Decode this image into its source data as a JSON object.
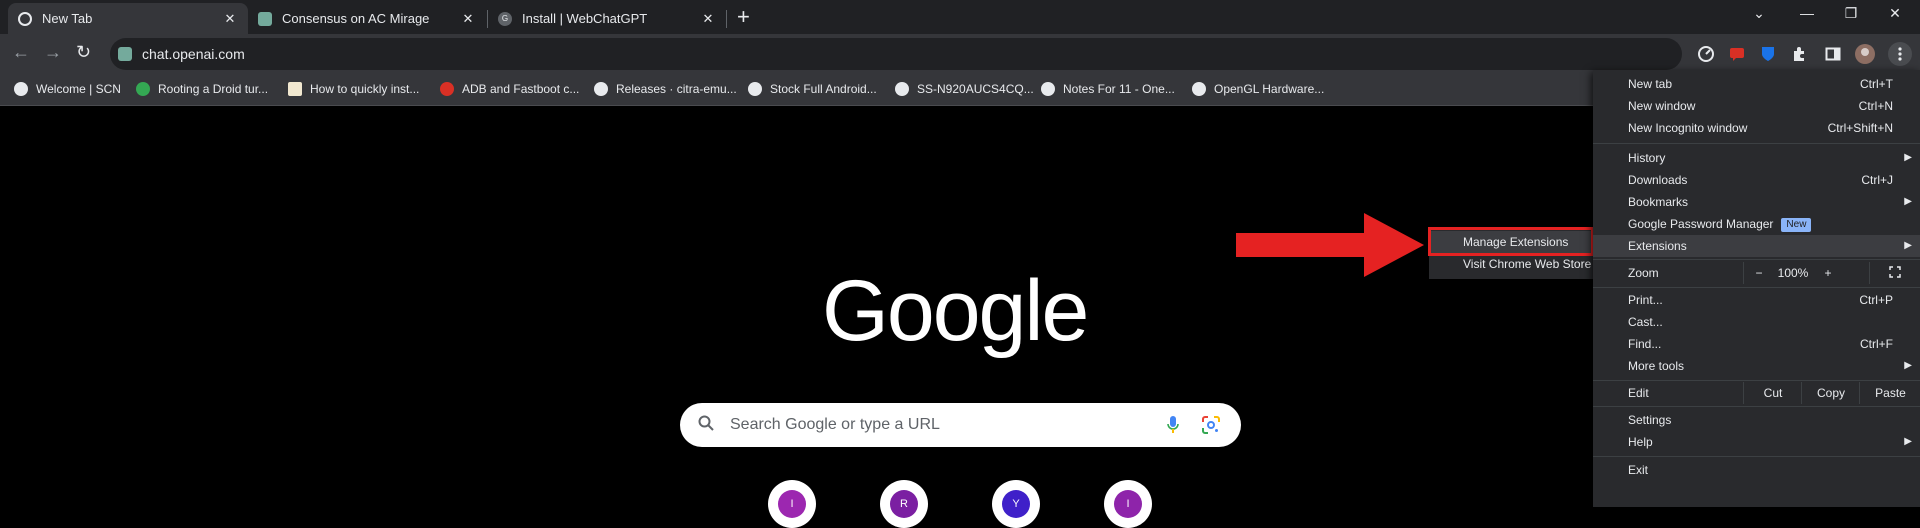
{
  "tabs": [
    {
      "title": "New Tab",
      "active": true
    },
    {
      "title": "Consensus on AC Mirage",
      "active": false
    },
    {
      "title": "Install | WebChatGPT",
      "active": false
    }
  ],
  "tab_close_glyph": "✕",
  "new_tab_glyph": "+",
  "window_controls": {
    "dropdown": "⌄",
    "minimize": "—",
    "restore": "❐",
    "close": "✕"
  },
  "toolbar": {
    "back_glyph": "←",
    "forward_glyph": "→",
    "reload_glyph": "↻",
    "url": "chat.openai.com"
  },
  "bookmarks": [
    {
      "label": "Welcome | SCN",
      "color": "#e8eaed"
    },
    {
      "label": "Rooting a Droid tur...",
      "color": "#34a853"
    },
    {
      "label": "How to quickly inst...",
      "color": "#f1e8d0"
    },
    {
      "label": "ADB and Fastboot c...",
      "color": "#d93025"
    },
    {
      "label": "Releases · citra-emu...",
      "color": "#e8eaed"
    },
    {
      "label": "Stock Full Android...",
      "color": "#e8eaed"
    },
    {
      "label": "SS-N920AUCS4CQ...",
      "color": "#e8eaed"
    },
    {
      "label": "Notes For 11 - One...",
      "color": "#e8eaed"
    },
    {
      "label": "OpenGL Hardware...",
      "color": "#e8eaed"
    }
  ],
  "page": {
    "logo": "Google",
    "search_placeholder": "Search Google or type a URL",
    "shortcuts": [
      {
        "letter": "I",
        "color": "#9c27b0"
      },
      {
        "letter": "R",
        "color": "#7b1fa2"
      },
      {
        "letter": "Y",
        "color": "#3f20c9"
      },
      {
        "letter": "I",
        "color": "#8e24aa"
      }
    ]
  },
  "submenu": {
    "manage": "Manage Extensions",
    "store": "Visit Chrome Web Store"
  },
  "menu": {
    "new_tab": {
      "label": "New tab",
      "shortcut": "Ctrl+T"
    },
    "new_window": {
      "label": "New window",
      "shortcut": "Ctrl+N"
    },
    "incognito": {
      "label": "New Incognito window",
      "shortcut": "Ctrl+Shift+N"
    },
    "history": {
      "label": "History"
    },
    "downloads": {
      "label": "Downloads",
      "shortcut": "Ctrl+J"
    },
    "bookmarks": {
      "label": "Bookmarks"
    },
    "password_manager": {
      "label": "Google Password Manager",
      "badge": "New"
    },
    "extensions": {
      "label": "Extensions"
    },
    "zoom": {
      "label": "Zoom",
      "minus": "−",
      "value": "100%",
      "plus": "+"
    },
    "print": {
      "label": "Print...",
      "shortcut": "Ctrl+P"
    },
    "cast": {
      "label": "Cast..."
    },
    "find": {
      "label": "Find...",
      "shortcut": "Ctrl+F"
    },
    "more_tools": {
      "label": "More tools"
    },
    "edit": {
      "label": "Edit",
      "cut": "Cut",
      "copy": "Copy",
      "paste": "Paste"
    },
    "settings": {
      "label": "Settings"
    },
    "help": {
      "label": "Help"
    },
    "exit": {
      "label": "Exit"
    }
  },
  "colors": {
    "annotation_red": "#e52222",
    "menu_bg": "#292a2d",
    "accent_badge": "#8ab4f8"
  }
}
